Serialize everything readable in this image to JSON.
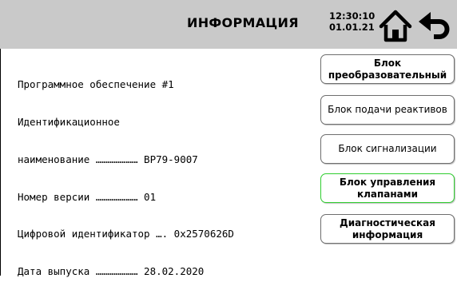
{
  "header": {
    "title": "ИНФОРМАЦИЯ",
    "time": "12:30:10",
    "date": "01.01.21",
    "home_icon": "home-icon",
    "back_icon": "back-arrow-icon",
    "background": "#c9c9c9"
  },
  "info": {
    "lines": [
      "Программное обеспечение #1",
      "Идентификационное",
      "наименование ………………… ВР79-9007",
      "Номер версии ………………… 01",
      "Цифровой идентификатор …. 0x2570626D",
      "Дата выпуска ………………… 28.02.2020"
    ]
  },
  "buttons": [
    {
      "line1": "Блок",
      "line2": "преобразовательный"
    },
    {
      "line1": "Блок подачи реактивов",
      "line2": ""
    },
    {
      "line1": "Блок сигнализации",
      "line2": ""
    },
    {
      "line1": "Блок управления",
      "line2": "клапанами",
      "active": true
    },
    {
      "line1": "Диагностическая",
      "line2": "информация"
    }
  ],
  "colors": {
    "active_border": "#2fcd2f",
    "button_border": "#6e6e6e"
  }
}
